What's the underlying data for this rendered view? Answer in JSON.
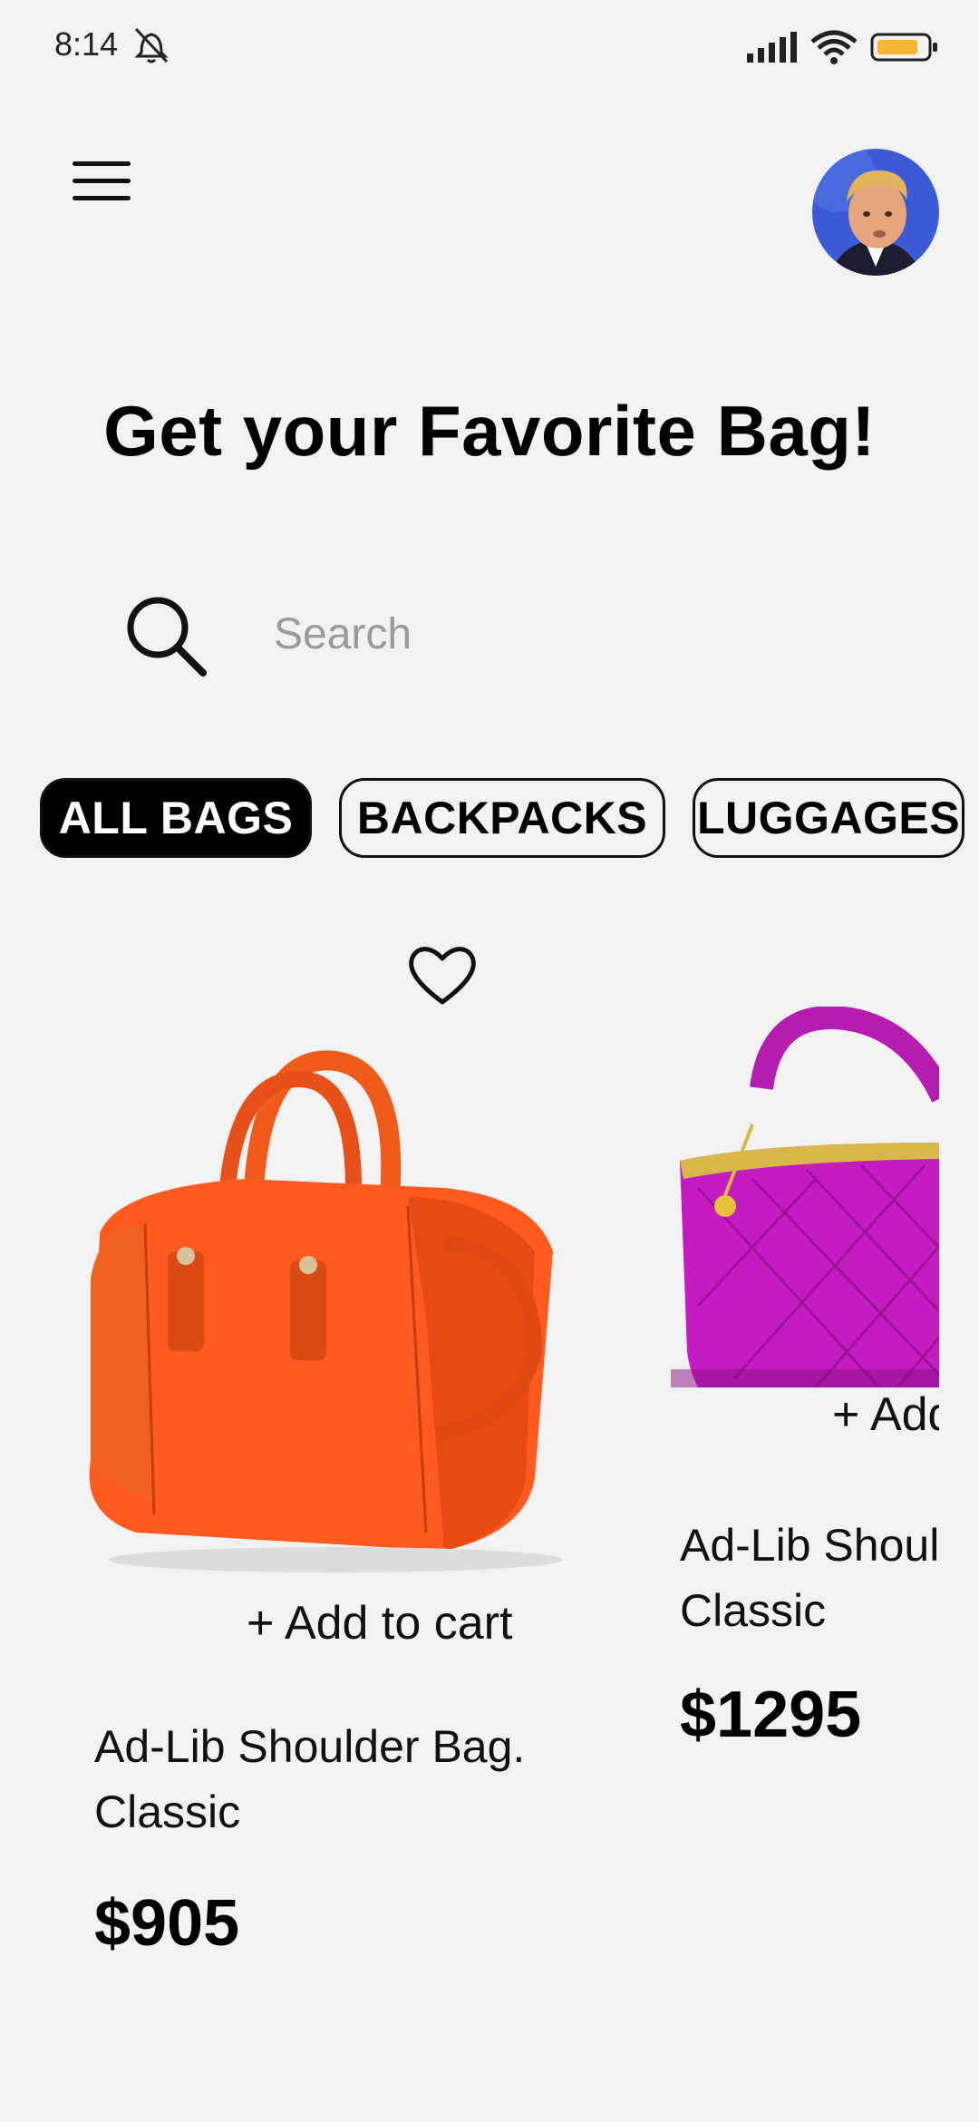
{
  "status_bar": {
    "time": "8:14"
  },
  "header": {
    "title": "Get your Favorite Bag!"
  },
  "search": {
    "placeholder": "Search"
  },
  "categories": [
    {
      "label": "ALL BAGS",
      "active": true
    },
    {
      "label": "BACKPACKS",
      "active": false
    },
    {
      "label": "LUGGAGES",
      "active": false
    }
  ],
  "products": [
    {
      "name": "Ad-Lib Shoulder Bag. Classic",
      "price": "$905",
      "add_label": "+ Add to cart",
      "color": "#ff5a1f"
    },
    {
      "name": "Ad-Lib Shoulder Bag. Classic",
      "price": "$1295",
      "add_label": "+ Add to cart",
      "color": "#c41cc0"
    }
  ],
  "icons": {
    "menu": "hamburger-icon",
    "search": "search-icon",
    "favorite": "heart-outline-icon",
    "battery": "battery-icon",
    "wifi": "wifi-icon",
    "signal": "signal-icon",
    "mute": "bell-muted-icon"
  },
  "colors": {
    "background": "#f2f2f2",
    "chip_active": "#000000",
    "battery": "#f5b731"
  }
}
